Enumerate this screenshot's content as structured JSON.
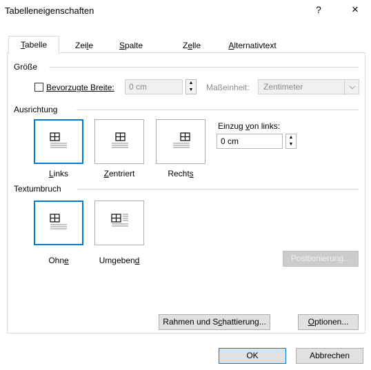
{
  "window": {
    "title": "Tabelleneigenschaften",
    "help_glyph": "?",
    "close_glyph": "×"
  },
  "tabs": [
    {
      "pre": "",
      "u": "T",
      "post": "abelle",
      "active": true
    },
    {
      "pre": "Zei",
      "u": "l",
      "post": "e",
      "active": false
    },
    {
      "pre": "",
      "u": "S",
      "post": "palte",
      "active": false
    },
    {
      "pre": "Z",
      "u": "e",
      "post": "lle",
      "active": false
    },
    {
      "pre": "",
      "u": "A",
      "post": "lternativtext",
      "active": false
    }
  ],
  "groesse": {
    "section": "Größe",
    "pref_width_checked": false,
    "pref_width_label": {
      "pre": "",
      "u": "B",
      "post": "evorzugte Breite:"
    },
    "pref_width_value": "0 cm",
    "unit_label": "Maßeinheit:",
    "unit_value": "Zentimeter"
  },
  "ausrichtung": {
    "section": "Ausrichtung",
    "options": [
      {
        "pre": "",
        "u": "L",
        "post": "inks",
        "selected": true
      },
      {
        "pre": "",
        "u": "Z",
        "post": "entriert",
        "selected": false
      },
      {
        "pre": "Recht",
        "u": "s",
        "post": "",
        "selected": false
      }
    ],
    "indent_label": {
      "pre": "Einzug ",
      "u": "v",
      "post": "on links:"
    },
    "indent_value": "0 cm"
  },
  "textumbruch": {
    "section": "Textumbruch",
    "options": [
      {
        "pre": "Ohn",
        "u": "e",
        "post": "",
        "selected": true
      },
      {
        "pre": "Umgeben",
        "u": "d",
        "post": "",
        "selected": false
      }
    ],
    "positioning_button": "Positionierung..."
  },
  "panel_buttons": {
    "borders": {
      "pre": "Rahmen und S",
      "u": "c",
      "post": "hattierung..."
    },
    "options": {
      "pre": "",
      "u": "O",
      "post": "ptionen..."
    }
  },
  "footer": {
    "ok": "OK",
    "cancel": "Abbrechen"
  },
  "colors": {
    "accent": "#0078d7",
    "border": "#d9d9d9",
    "button": "#e1e1e1"
  }
}
